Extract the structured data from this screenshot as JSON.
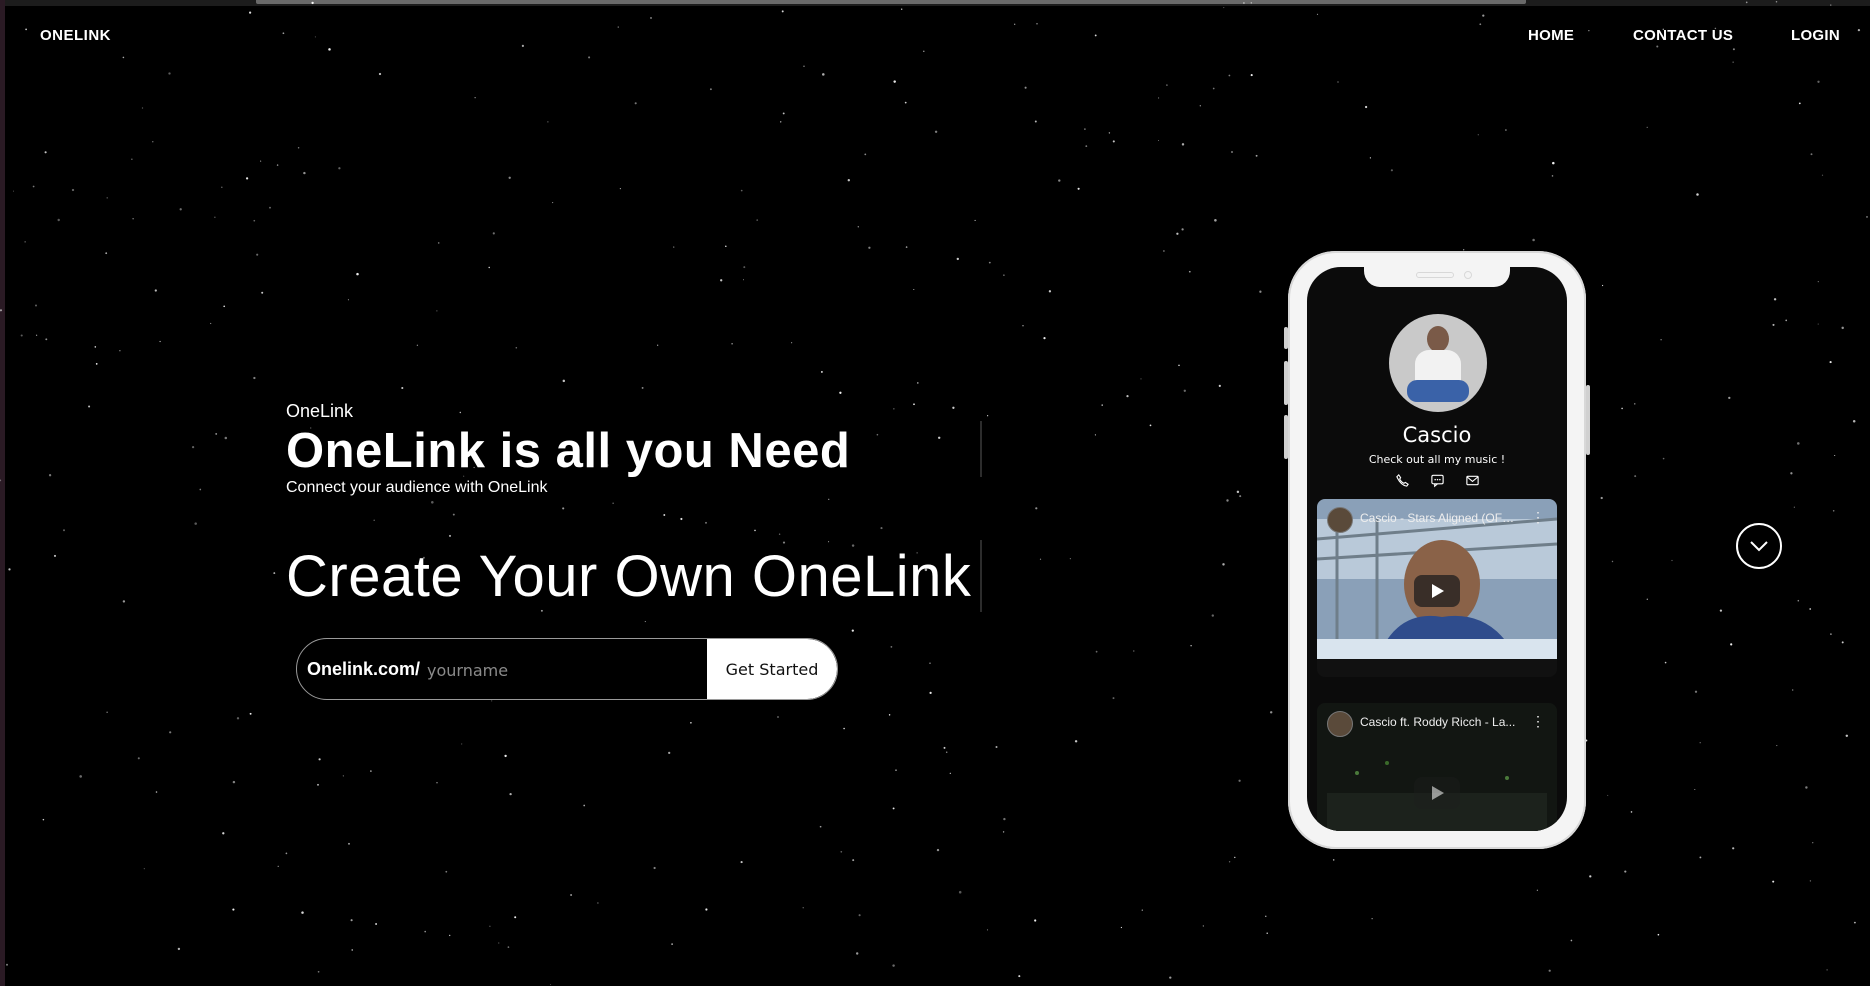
{
  "nav": {
    "brand": "ONELINK",
    "links": [
      "HOME",
      "CONTACT US",
      "LOGIN"
    ]
  },
  "hero": {
    "eyebrow": "OneLink",
    "title": "OneLink is all you Need",
    "subtitle": "Connect your audience with OneLink",
    "create_title": "Create Your Own OneLink"
  },
  "signup": {
    "prefix": "Onelink.com/",
    "placeholder": "yourname",
    "button_label": "Get Started"
  },
  "phone_preview": {
    "name": "Cascio",
    "bio": "Check out all my music !",
    "contact_icons": [
      "phone-icon",
      "message-icon",
      "mail-icon"
    ],
    "videos": [
      {
        "title": "Cascio - Stars Aligned (OFFICIAL VIDEO)"
      },
      {
        "title": "Cascio ft. Roddy Ricch - La..."
      }
    ]
  },
  "scroll_down_icon": "chevron-down-icon",
  "colors": {
    "background": "#000000",
    "text": "#ffffff",
    "phone_frame": "#f4f4f4",
    "screen": "#0b0b0b"
  }
}
